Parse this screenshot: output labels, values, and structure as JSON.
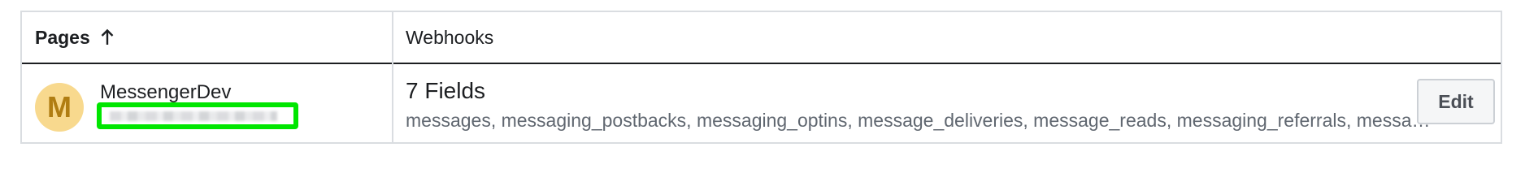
{
  "table": {
    "headers": {
      "pages": "Pages",
      "pages_sort_icon": "arrow-up-icon",
      "webhooks": "Webhooks"
    },
    "rows": [
      {
        "avatar_letter": "M",
        "avatar_color": "#f8d98e",
        "page_name": "MessengerDev",
        "page_id_redacted": true,
        "fields_count": "7 Fields",
        "fields_list": "messages, messaging_postbacks, messaging_optins, message_deliveries, message_reads, messaging_referrals, messaging_handovers",
        "edit_label": "Edit"
      }
    ]
  },
  "colors": {
    "highlight": "#00e600",
    "border": "#dadde1",
    "header_rule": "#1c1e21",
    "secondary_text": "#606770"
  }
}
